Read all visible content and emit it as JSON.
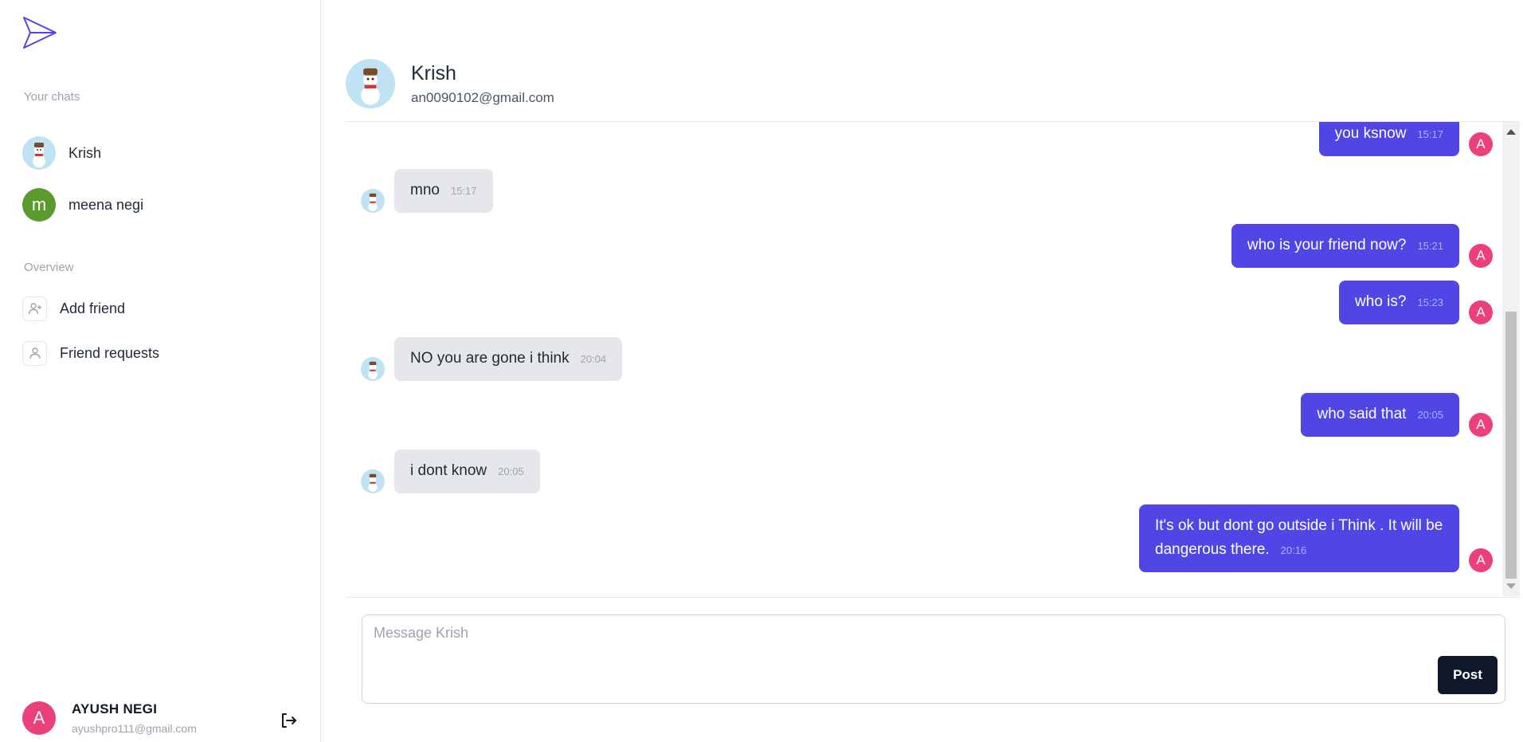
{
  "sidebar": {
    "your_chats_label": "Your chats",
    "chats": [
      {
        "name": "Krish",
        "avatar": "snowman-avatar"
      },
      {
        "name": "meena negi",
        "avatar_letter": "m",
        "avatar_color": "#5a9a2e"
      }
    ],
    "overview_label": "Overview",
    "overview_items": [
      {
        "label": "Add friend",
        "icon": "user-plus-icon"
      },
      {
        "label": "Friend requests",
        "icon": "user-icon"
      }
    ],
    "profile": {
      "name": "AYUSH NEGI",
      "email": "ayushpro111@gmail.com",
      "avatar_letter": "A"
    }
  },
  "chat": {
    "partner_name": "Krish",
    "partner_email": "an0090102@gmail.com",
    "messages": [
      {
        "direction": "out",
        "text": "you ksnow",
        "time": "15:17"
      },
      {
        "direction": "in",
        "text": "mno",
        "time": "15:17"
      },
      {
        "direction": "out",
        "text": "who is your friend now?",
        "time": "15:21"
      },
      {
        "direction": "out",
        "text": "who is?",
        "time": "15:23"
      },
      {
        "direction": "in",
        "text": "NO you are gone i think",
        "time": "20:04"
      },
      {
        "direction": "out",
        "text": "who said that",
        "time": "20:05"
      },
      {
        "direction": "in",
        "text": "i dont know",
        "time": "20:05"
      },
      {
        "direction": "out",
        "text": "It's ok but dont go outside i Think . It will be dangerous there.",
        "time": "20:16"
      }
    ],
    "own_avatar_letter": "A"
  },
  "composer": {
    "placeholder": "Message Krish",
    "value": "",
    "post_label": "Post"
  },
  "colors": {
    "accent": "#4f46e5",
    "incoming_bubble": "#e5e7eb",
    "own_avatar": "#ec407a",
    "post_button": "#0f172a"
  }
}
